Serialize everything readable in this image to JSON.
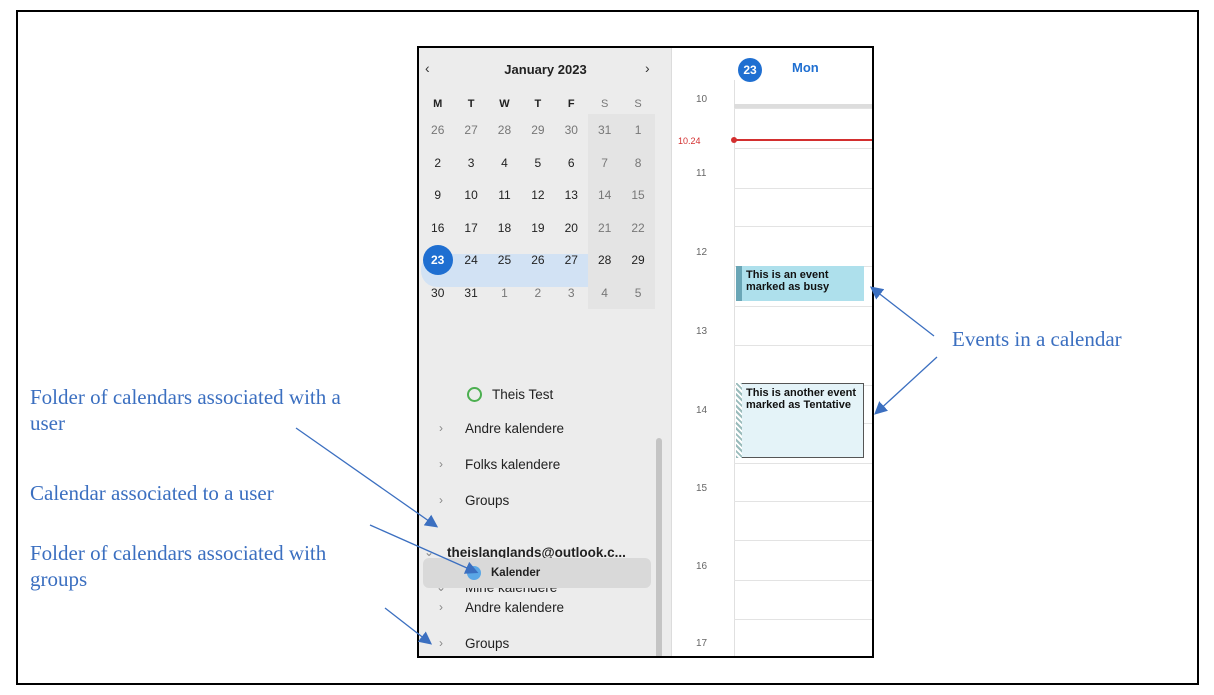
{
  "mini_calendar": {
    "prev": "‹",
    "next": "›",
    "month": "January 2023",
    "weekdays": [
      "M",
      "T",
      "W",
      "T",
      "F",
      "S",
      "S"
    ],
    "weeks": [
      [
        "26",
        "27",
        "28",
        "29",
        "30",
        "31",
        "1"
      ],
      [
        "2",
        "3",
        "4",
        "5",
        "6",
        "7",
        "8"
      ],
      [
        "9",
        "10",
        "11",
        "12",
        "13",
        "14",
        "15"
      ],
      [
        "16",
        "17",
        "18",
        "19",
        "20",
        "21",
        "22"
      ],
      [
        "23",
        "24",
        "25",
        "26",
        "27",
        "28",
        "29"
      ],
      [
        "30",
        "31",
        "1",
        "2",
        "3",
        "4",
        "5"
      ]
    ],
    "today": "23"
  },
  "sidebar": {
    "theis_test": "Theis Test",
    "andre_1": "Andre kalendere",
    "folks": "Folks kalendere",
    "groups_1": "Groups",
    "account": "theislanglands@outlook.c...",
    "mine": "Mine kalendere",
    "kalender": "Kalender",
    "andre_2": "Andre kalendere",
    "groups_2": "Groups",
    "chevron_right": "›",
    "chevron_down": "⌄"
  },
  "day_view": {
    "date_num": "23",
    "day_name": "Mon",
    "hours": [
      "10",
      "11",
      "12",
      "13",
      "14",
      "15",
      "16",
      "17"
    ],
    "now_time": "10.24",
    "events": {
      "busy": "This is an event marked as busy",
      "tentative": "This is another event marked as Tentative"
    }
  },
  "annotations": {
    "folder_user": "Folder of calendars associated with a user",
    "calendar_user": "Calendar associated to a user",
    "folder_groups": "Folder of calendars associated with groups",
    "events": "Events in a calendar"
  },
  "colors": {
    "accent": "#1f6fd1",
    "annotation": "#3b6fc0",
    "now_line": "#d32f2f"
  }
}
